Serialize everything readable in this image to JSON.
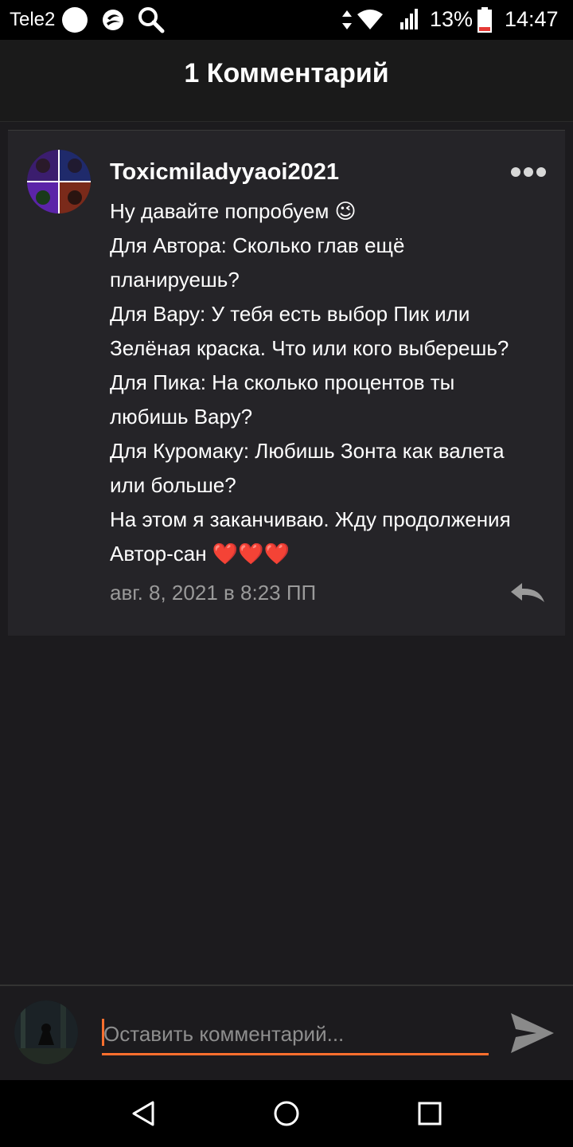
{
  "status_bar": {
    "carrier": "Tele2",
    "battery_percent": "13%",
    "time": "14:47",
    "icons": [
      "circle-icon",
      "moon-icon",
      "search-icon",
      "data-arrows-icon",
      "wifi-icon",
      "signal-icon",
      "battery-icon"
    ]
  },
  "header": {
    "title": "1 Комментарий"
  },
  "comment": {
    "username": "Toxicmiladyyaoi2021",
    "lines": [
      "Ну давайте попробуем 😉",
      "Для Автора: Сколько глав ещё",
      "планируешь?",
      "Для Вару: У тебя есть выбор Пик или",
      "Зелёная краска. Что или кого выберешь?",
      "Для Пика: На сколько процентов ты",
      "любишь Вару?",
      "Для Куромаку: Любишь Зонта как валета",
      "или больше?",
      "На этом я заканчиваю. Жду продолжения",
      "Автор-сан ❤️❤️❤️"
    ],
    "timestamp": "авг. 8, 2021 в 8:23 ПП"
  },
  "composer": {
    "placeholder": "Оставить комментарий...",
    "value": ""
  },
  "colors": {
    "accent": "#ff6f2e",
    "background": "#1c1b1e",
    "card": "#252428",
    "muted": "#9a9a9a"
  }
}
